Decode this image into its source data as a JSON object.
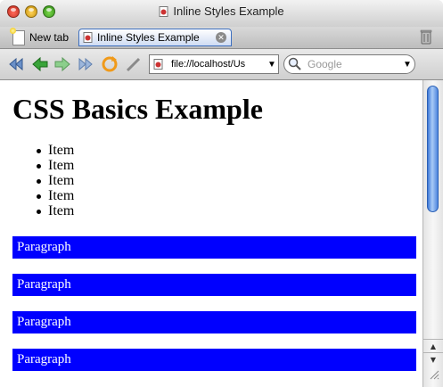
{
  "window": {
    "title": "Inline Styles Example"
  },
  "tabs": {
    "new_tab_label": "New tab",
    "active_tab_label": "Inline Styles Example"
  },
  "toolbar": {
    "url": "file://localhost/Us",
    "search_placeholder": "Google"
  },
  "page": {
    "heading": "CSS Basics Example",
    "items": [
      "Item",
      "Item",
      "Item",
      "Item",
      "Item"
    ],
    "paragraphs": [
      "Paragraph",
      "Paragraph",
      "Paragraph",
      "Paragraph"
    ]
  },
  "colors": {
    "paragraph_background": "#0000ff",
    "paragraph_text": "#ffffff"
  },
  "icons": [
    "close-icon",
    "minimize-icon",
    "zoom-icon",
    "page-icon",
    "tab-close-icon",
    "trash-icon",
    "back-icon",
    "forward-icon",
    "fast-forward-icon",
    "reload-icon",
    "edit-icon",
    "search-icon",
    "dropdown-icon"
  ]
}
